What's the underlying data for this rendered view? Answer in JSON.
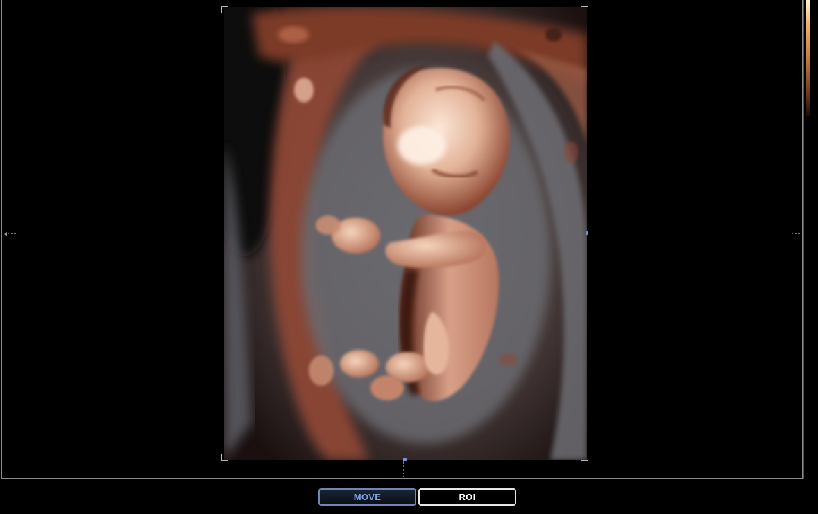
{
  "controls": {
    "move_label": "MOVE",
    "roi_label": "ROI",
    "active": "MOVE"
  },
  "colors": {
    "background": "#000000",
    "tissue_dark": "#5a2a1c",
    "tissue_mid": "#a0553a",
    "tissue_light": "#f3d6c0",
    "fluid_gray": "#6b6b70",
    "move_accent": "#7ea2e6",
    "roi_border": "#e6e6e6",
    "handle_blue": "#6f93d6"
  },
  "icons": {
    "left_marker": "triangle-left-marker",
    "colorbar": "render-colorbar"
  }
}
